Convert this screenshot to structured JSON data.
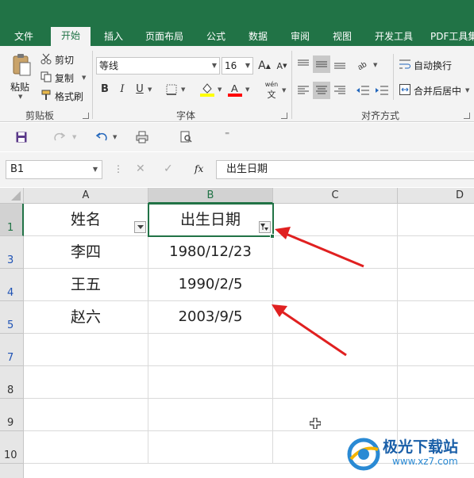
{
  "tabs": [
    "文件",
    "开始",
    "插入",
    "页面布局",
    "公式",
    "数据",
    "审阅",
    "视图",
    "开发工具",
    "PDF工具集"
  ],
  "active_tab": "开始",
  "clipboard": {
    "paste": "粘贴",
    "cut": "剪切",
    "copy": "复制",
    "format_painter": "格式刷",
    "group_label": "剪贴板"
  },
  "font": {
    "name": "等线",
    "size": "16",
    "grow": "A",
    "shrink": "A",
    "bold": "B",
    "italic": "I",
    "underline": "U",
    "phonetic": "wén",
    "group_label": "字体",
    "highlight_color": "#ffff00",
    "font_color": "#ff0000"
  },
  "alignment": {
    "wrap_text": "自动换行",
    "merge_center": "合并后居中",
    "group_label": "对齐方式"
  },
  "formula_bar": {
    "name_box": "B1",
    "fx": "fx",
    "content": "出生日期"
  },
  "sheet": {
    "columns": [
      "A",
      "B",
      "C",
      "D"
    ],
    "row_labels": [
      "1",
      "3",
      "4",
      "5",
      "7",
      "8",
      "9",
      "10"
    ],
    "header": [
      "姓名",
      "出生日期"
    ],
    "rows": [
      [
        "李四",
        "1980/12/23"
      ],
      [
        "王五",
        "1990/2/5"
      ],
      [
        "赵六",
        "2003/9/5"
      ]
    ]
  },
  "colors": {
    "excel_green": "#217346",
    "arrow_red": "#e02020",
    "hidden_row_number": "#1f53b5"
  },
  "watermark": {
    "text": "极光下载站",
    "url": "www.xz7.com"
  }
}
